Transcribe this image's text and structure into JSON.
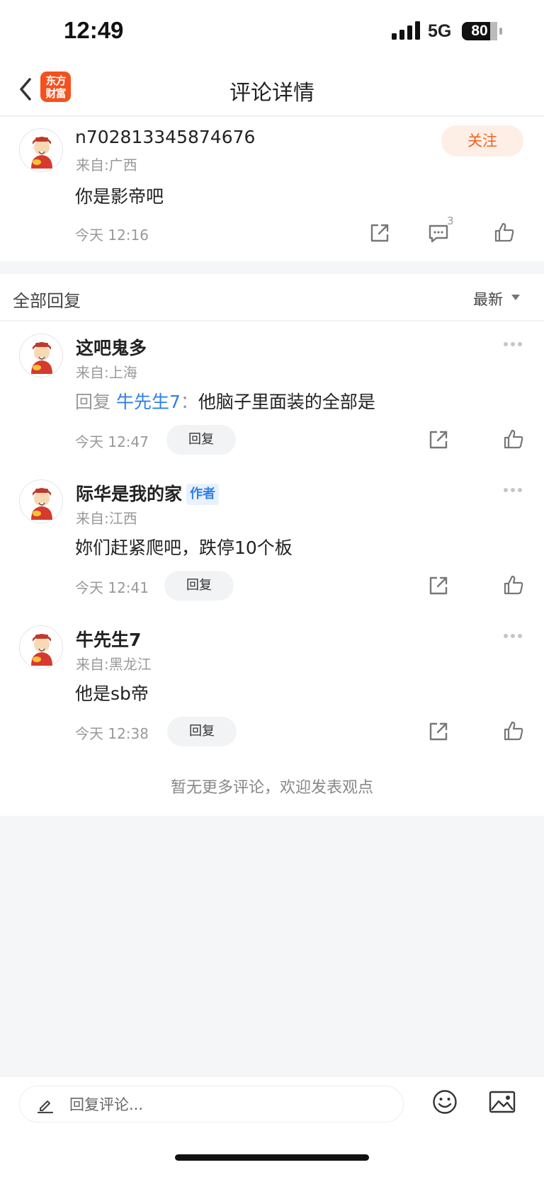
{
  "status_bar": {
    "time": "12:49",
    "network": "5G",
    "battery": "80"
  },
  "nav": {
    "logo_text": "东方财富",
    "title": "评论详情"
  },
  "main_comment": {
    "username": "n702813345874676",
    "location": "来自:广西",
    "content": "你是影帝吧",
    "time": "今天 12:16",
    "follow_label": "关注",
    "comment_count": "3"
  },
  "replies_section": {
    "title": "全部回复",
    "sort_label": "最新"
  },
  "replies": [
    {
      "username": "这吧鬼多",
      "location": "来自:上海",
      "reply_prefix": "回复",
      "reply_target": "牛先生7",
      "colon": "：",
      "content": "他脑子里面装的全部是",
      "time": "今天 12:47",
      "reply_label": "回复"
    },
    {
      "username": "际华是我的家",
      "author_tag": "作者",
      "location": "来自:江西",
      "content": "妳们赶紧爬吧，跌停10个板",
      "time": "今天 12:41",
      "reply_label": "回复"
    },
    {
      "username": "牛先生7",
      "location": "来自:黑龙江",
      "content": "他是sb帝",
      "time": "今天 12:38",
      "reply_label": "回复"
    }
  ],
  "no_more_text": "暂无更多评论，欢迎发表观点",
  "bottom_bar": {
    "input_placeholder": "回复评论..."
  },
  "colors": {
    "accent_orange": "#f0641e",
    "link_blue": "#2f7fe6",
    "logo_bg": "#f4511e"
  }
}
